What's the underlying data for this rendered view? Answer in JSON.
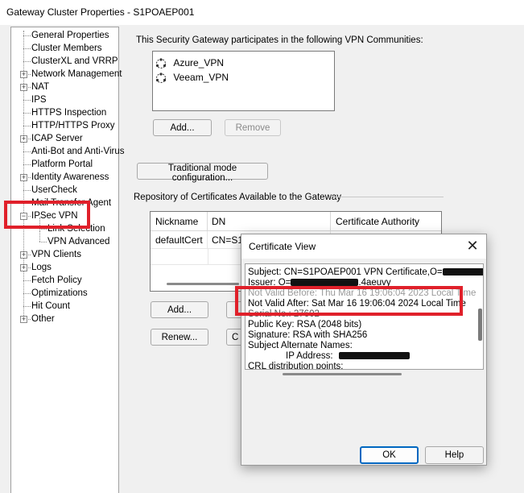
{
  "window": {
    "title": "Gateway Cluster Properties - S1POAEP001"
  },
  "tree": {
    "items": [
      {
        "label": "General Properties",
        "expandable": false,
        "level": 0
      },
      {
        "label": "Cluster Members",
        "expandable": false,
        "level": 0
      },
      {
        "label": "ClusterXL and VRRP",
        "expandable": false,
        "level": 0
      },
      {
        "label": "Network Management",
        "expandable": true,
        "level": 0
      },
      {
        "label": "NAT",
        "expandable": true,
        "level": 0
      },
      {
        "label": "IPS",
        "expandable": false,
        "level": 0
      },
      {
        "label": "HTTPS Inspection",
        "expandable": false,
        "level": 0
      },
      {
        "label": "HTTP/HTTPS Proxy",
        "expandable": false,
        "level": 0
      },
      {
        "label": "ICAP Server",
        "expandable": true,
        "level": 0
      },
      {
        "label": "Anti-Bot and Anti-Virus",
        "expandable": false,
        "level": 0
      },
      {
        "label": "Platform Portal",
        "expandable": false,
        "level": 0
      },
      {
        "label": "Identity Awareness",
        "expandable": true,
        "level": 0
      },
      {
        "label": "UserCheck",
        "expandable": false,
        "level": 0
      },
      {
        "label": "Mail Transfer Agent",
        "expandable": false,
        "level": 0
      },
      {
        "label": "IPSec VPN",
        "expandable": true,
        "level": 0,
        "expanded": true
      },
      {
        "label": "Link Selection",
        "expandable": false,
        "level": 1
      },
      {
        "label": "VPN Advanced",
        "expandable": false,
        "level": 1
      },
      {
        "label": "VPN Clients",
        "expandable": true,
        "level": 0
      },
      {
        "label": "Logs",
        "expandable": true,
        "level": 0
      },
      {
        "label": "Fetch Policy",
        "expandable": false,
        "level": 0
      },
      {
        "label": "Optimizations",
        "expandable": false,
        "level": 0
      },
      {
        "label": "Hit Count",
        "expandable": false,
        "level": 0
      },
      {
        "label": "Other",
        "expandable": true,
        "level": 0
      }
    ]
  },
  "vpn": {
    "communities_label": "This Security Gateway participates in the following VPN Communities:",
    "communities": [
      {
        "name": "Azure_VPN",
        "icon": "vpn-community-icon"
      },
      {
        "name": "Veeam_VPN",
        "icon": "vpn-community-icon"
      }
    ],
    "add_label": "Add...",
    "remove_label": "Remove",
    "traditional_mode_label": "Traditional mode configuration...",
    "repository_label": "Repository of Certificates Available to the Gateway",
    "cert_columns": [
      "Nickname",
      "DN",
      "Certificate Authority"
    ],
    "cert_rows": [
      {
        "nickname": "defaultCert",
        "dn": "CN=S1P",
        "ca": ""
      }
    ],
    "cert_add_label": "Add...",
    "renew_label": "Renew...",
    "cert_c_label": "C"
  },
  "cert_dialog": {
    "title": "Certificate View",
    "subject": "Subject: CN=S1POAEP001 VPN Certificate,O=",
    "issuer_prefix": "Issuer: O=",
    "issuer_suffix": ".4aeuvy",
    "not_valid_before": "Not Valid Before:  Thu Mar 16 19:06:04 2023 Local Time",
    "not_valid_after": "Not Valid After:  Sat Mar 16 19:06:04 2024 Local Time",
    "serial": "Serial No.: 27602",
    "public_key": "Public Key: RSA (2048 bits)",
    "signature": "Signature: RSA with SHA256",
    "san_label": "Subject Alternate Names:",
    "ip_label": "IP Address:",
    "crl": "CRL distribution points:",
    "ok_label": "OK",
    "help_label": "Help"
  },
  "colors": {
    "highlight": "#e0202a",
    "accent_button": "#0067c0"
  }
}
